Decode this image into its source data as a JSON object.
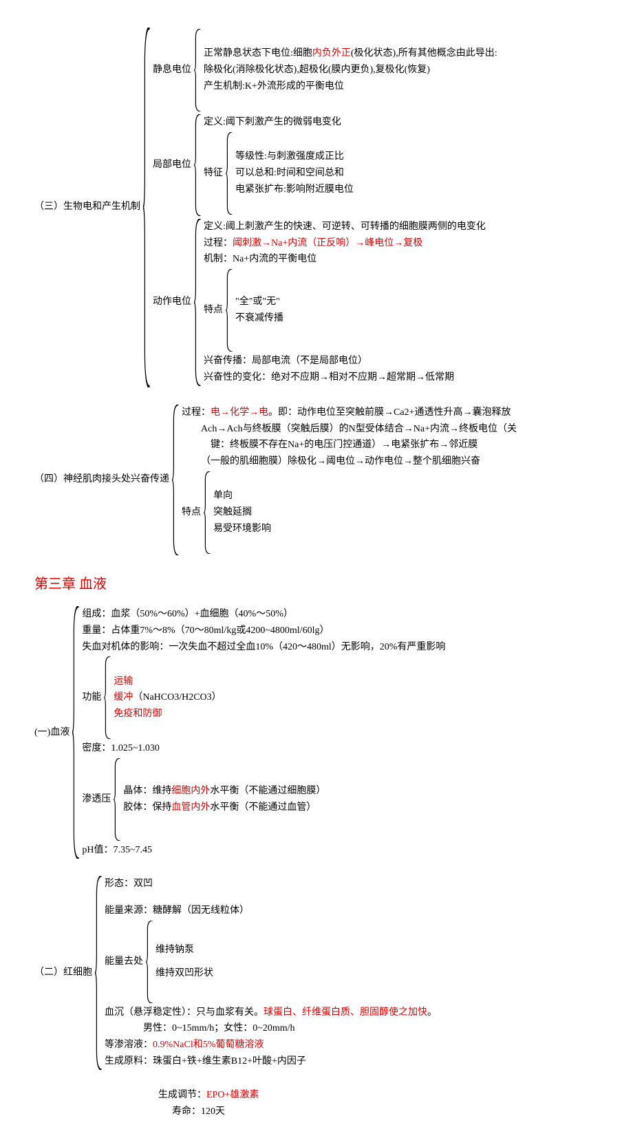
{
  "s3": {
    "title": "（三）生物电和产生机制",
    "resting": {
      "label": "静息电位",
      "l1a": "正常静息状态下电位:细胞",
      "l1b": "内负外正",
      "l1c": "(极化状态),所有其他概念由此导出:",
      "l2": "除极化(消除极化状态),超极化(膜内更负),复极化(恢复)",
      "l3": "产生机制:K+外流形成的平衡电位"
    },
    "local": {
      "label": "局部电位",
      "def": "定义:阈下刺激产生的微弱电变化",
      "feat": "特征",
      "f1": "等级性:与刺激强度成正比",
      "f2": "可以总和:时间和空间总和",
      "f3": "电紧张扩布:影响附近膜电位"
    },
    "action": {
      "label": "动作电位",
      "def": "定义:阈上刺激产生的快速、可逆转、可转播的细胞膜两侧的电变化",
      "proca": "过程：",
      "procb": "阈刺激→Na+内流（正反响）→峰电位→复极",
      "mech": "机制：Na+内流的平衡电位",
      "feat": "特点",
      "f1": "\"全\"或\"无\"",
      "f2": "不衰减传播",
      "spread": "兴奋传播：局部电流（不是局部电位）",
      "change": "兴奋性的变化：绝对不应期→相对不应期→超常期→低常期"
    }
  },
  "s4": {
    "title": "（四）神经肌肉接头处兴奋传递",
    "proca": "过程：",
    "procb": "电→化学→电",
    "procc": "。即：动作电位至突触前膜→Ca2+通透性升高→囊泡释放",
    "proc2": "Ach→Ach与终板膜（突触后膜）的N型受体结合→Na+内流→终板电位（关",
    "proc3": "键：终板膜不存在Na+的电压门控通道）→电紧张扩布→邻近膜",
    "proc4": "（一般的肌细胞膜）除极化→阈电位→动作电位→整个肌细胞兴奋",
    "feat": "特点",
    "f1": "单向",
    "f2": "突触延搁",
    "f3": "易受环境影响"
  },
  "ch3": "第三章 血液",
  "b1": {
    "title": "(一)血液",
    "comp": "组成：血浆（50%～60%）+血细胞（40%～50%）",
    "weight": "重量：占体重7%～8%（70～80ml/kg或4200~4800ml/60lg）",
    "loss": "失血对机体的影响：一次失血不超过全血10%（420～480ml）无影响，20%有严重影响",
    "func": "功能",
    "fu1": "运输",
    "fu2a": "缓冲",
    "fu2b": "（NaHCO3/H2CO3）",
    "fu3": "免疫和防御",
    "density": "密度：1.025~1.030",
    "osm": "渗透压",
    "o1a": "晶体：维持",
    "o1b": "细胞内外",
    "o1c": "水平衡（不能通过细胞膜）",
    "o2a": "胶体：保持",
    "o2b": "血管内外",
    "o2c": "水平衡（不能通过血管）",
    "ph": "pH值：7.35~7.45"
  },
  "b2": {
    "title": "（二）红细胞",
    "shape": "形态：双凹",
    "energy": "能量来源：糖酵解（因无线粒体）",
    "euse": "能量去处",
    "e1": "维持钠泵",
    "e2": "维持双凹形状",
    "esra": "血沉（悬浮稳定性）：只与血浆有关。",
    "esrb": "球蛋白、纤维蛋白质、胆固醇使之加快",
    "esrc": "。",
    "esr2": "男性：0~15mm/h；女性：0~20mm/h",
    "isoa": "等渗溶液：",
    "isob": "0.9%NaCl和5%葡萄糖溶液",
    "raw": "生成原料：珠蛋白+铁+维生素B12+叶酸+内因子",
    "rega": "生成调节：",
    "regb": "EPO+雄激素",
    "life": "寿命：120天"
  }
}
